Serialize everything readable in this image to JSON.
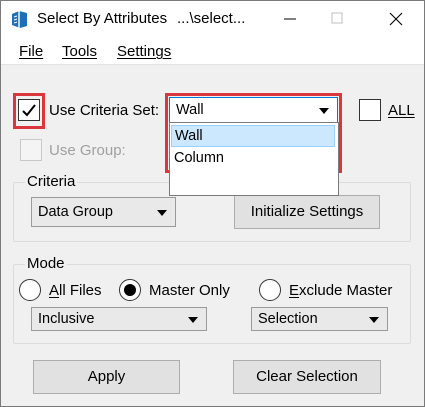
{
  "window": {
    "title": "Select By Attributes",
    "path": "...\\select..."
  },
  "menu": {
    "file": "File",
    "tools": "Tools",
    "settings": "Settings"
  },
  "criteria_set": {
    "checked": true,
    "label": "Use Criteria Set:",
    "selected": "Wall",
    "options": [
      "Wall",
      "Column"
    ]
  },
  "all": {
    "checked": false,
    "label": "ALL"
  },
  "use_group": {
    "checked": false,
    "enabled": false,
    "label": "Use Group:"
  },
  "criteria": {
    "legend": "Criteria",
    "data_group": "Data Group",
    "initialize_button": "Initialize Settings"
  },
  "mode": {
    "legend": "Mode",
    "all_files": "All Files",
    "master_only": "Master Only",
    "exclude_master": "Exclude Master",
    "selected_mode": "Master Only",
    "method": "Inclusive",
    "action": "Selection"
  },
  "buttons": {
    "apply": "Apply",
    "clear_selection": "Clear Selection"
  },
  "colors": {
    "highlight_border": "#d9363e",
    "selected_item_bg": "#cce8ff"
  }
}
